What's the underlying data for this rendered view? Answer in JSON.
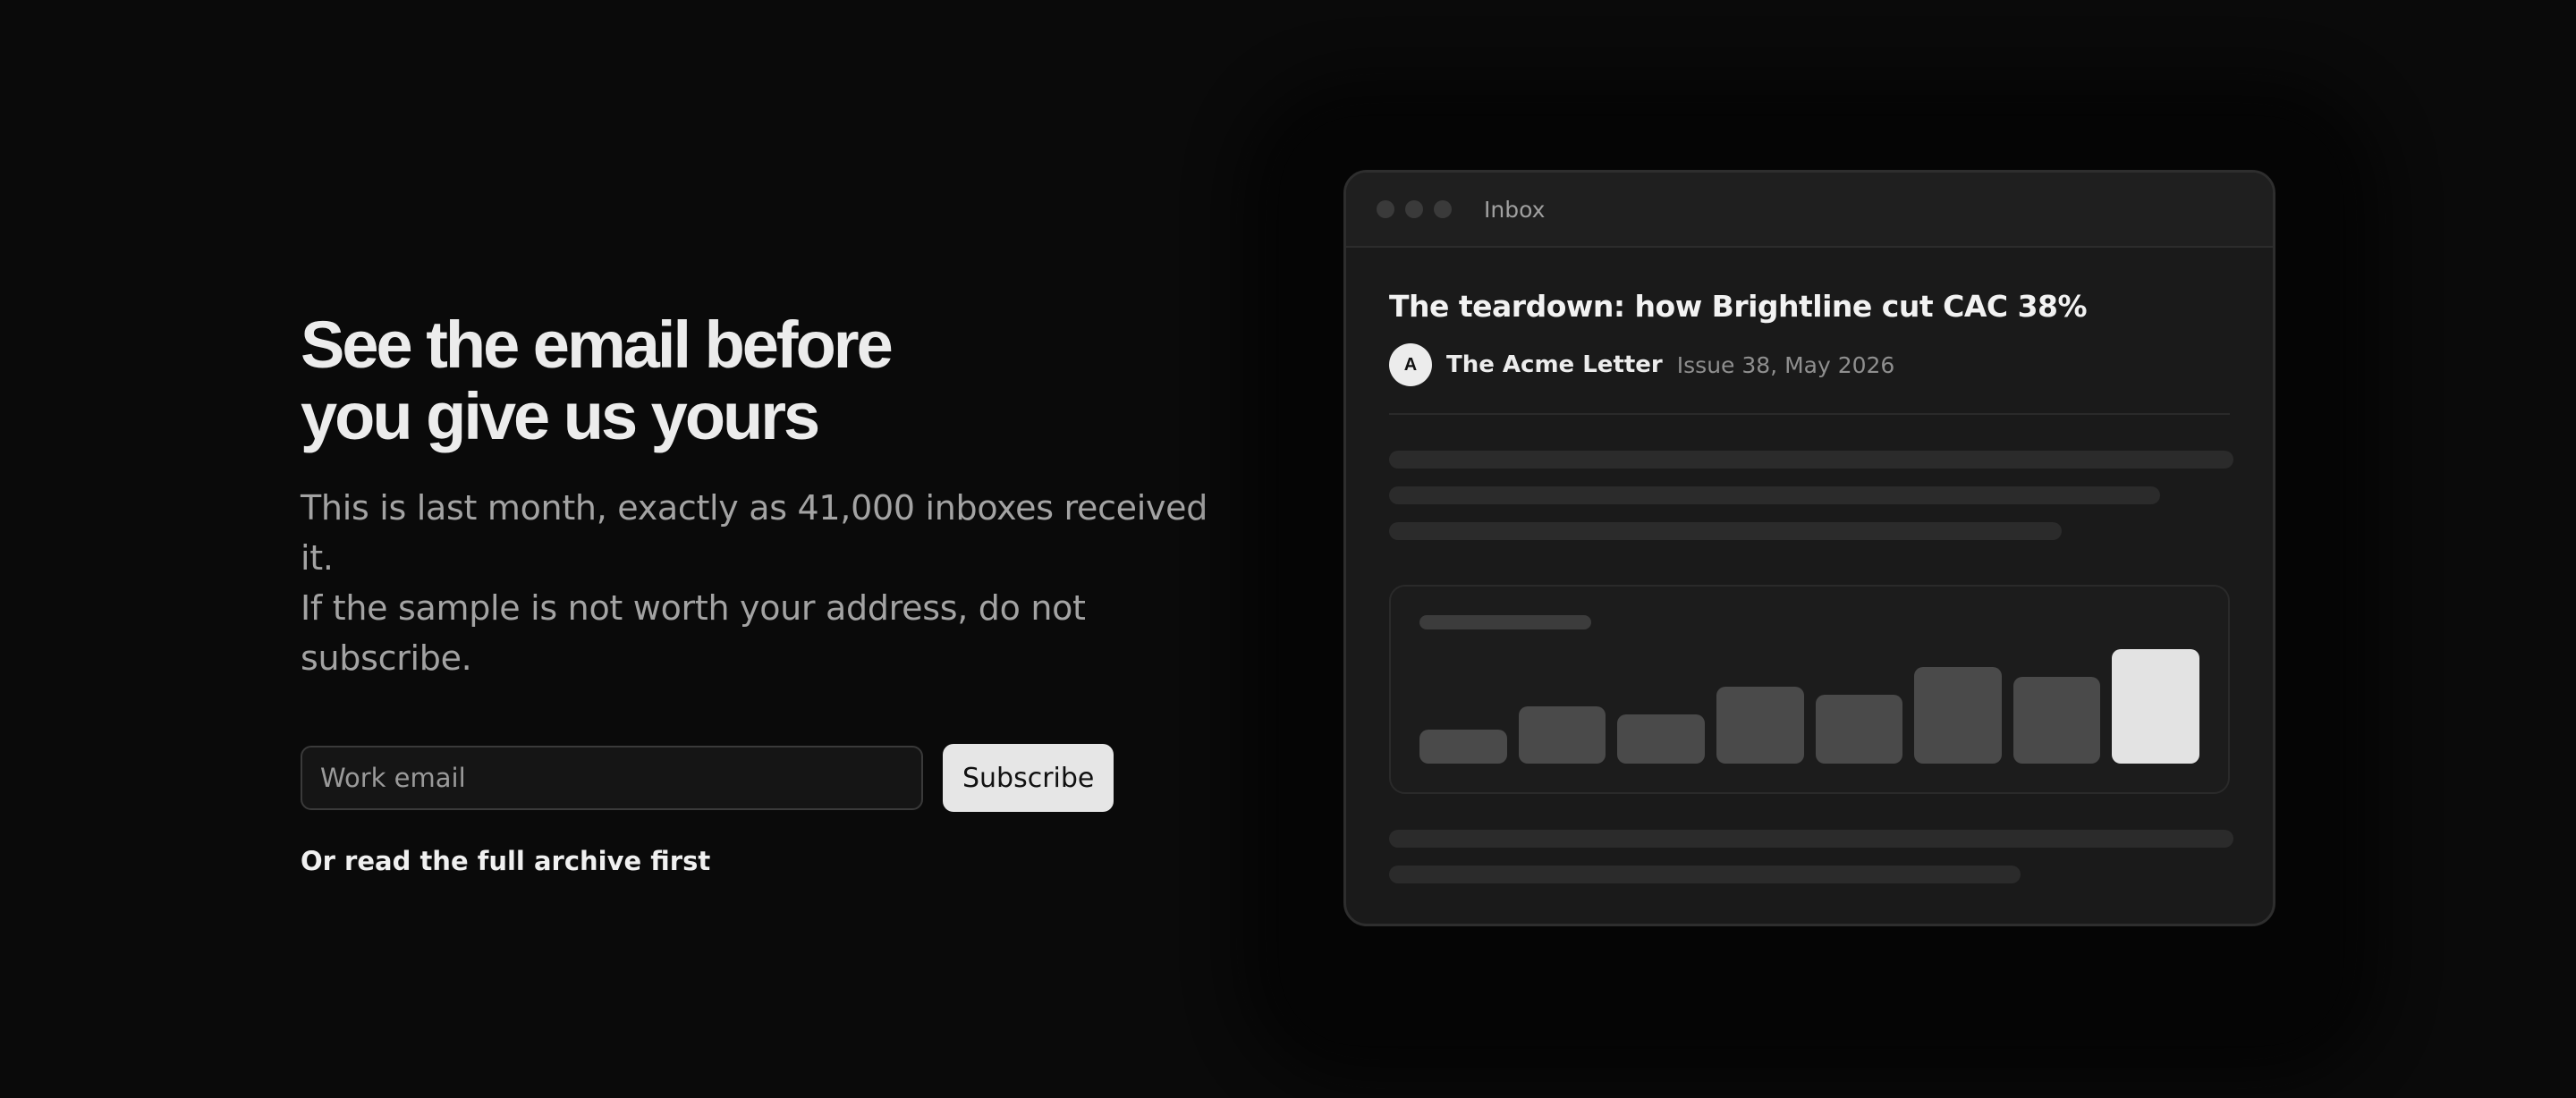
{
  "hero": {
    "headline_line1": "See the email before",
    "headline_line2": "you give us yours",
    "subcopy_line1": "This is last month, exactly as 41,000 inboxes received it.",
    "subcopy_line2": "If the sample is not worth your address, do not subscribe.",
    "email_placeholder": "Work email",
    "subscribe_label": "Subscribe",
    "archive_link": "Or read the full archive first"
  },
  "preview": {
    "window_title": "Inbox",
    "subject": "The teardown: how Brightline cut CAC 38%",
    "avatar_initial": "A",
    "sender": "The Acme Letter",
    "issue_meta": "Issue 38, May 2026",
    "chart_data": {
      "type": "bar",
      "values": [
        3,
        5,
        4.3,
        6.7,
        6,
        8.4,
        7.6,
        10
      ],
      "highlight_index": 7,
      "colors": {
        "bar": "#4a4a4a",
        "highlight": "#e3e3e3"
      }
    }
  },
  "colors": {
    "background": "#0a0a0a",
    "headline": "#ececec",
    "subcopy": "#a3a3a3",
    "button_bg": "#e6e6e6"
  }
}
